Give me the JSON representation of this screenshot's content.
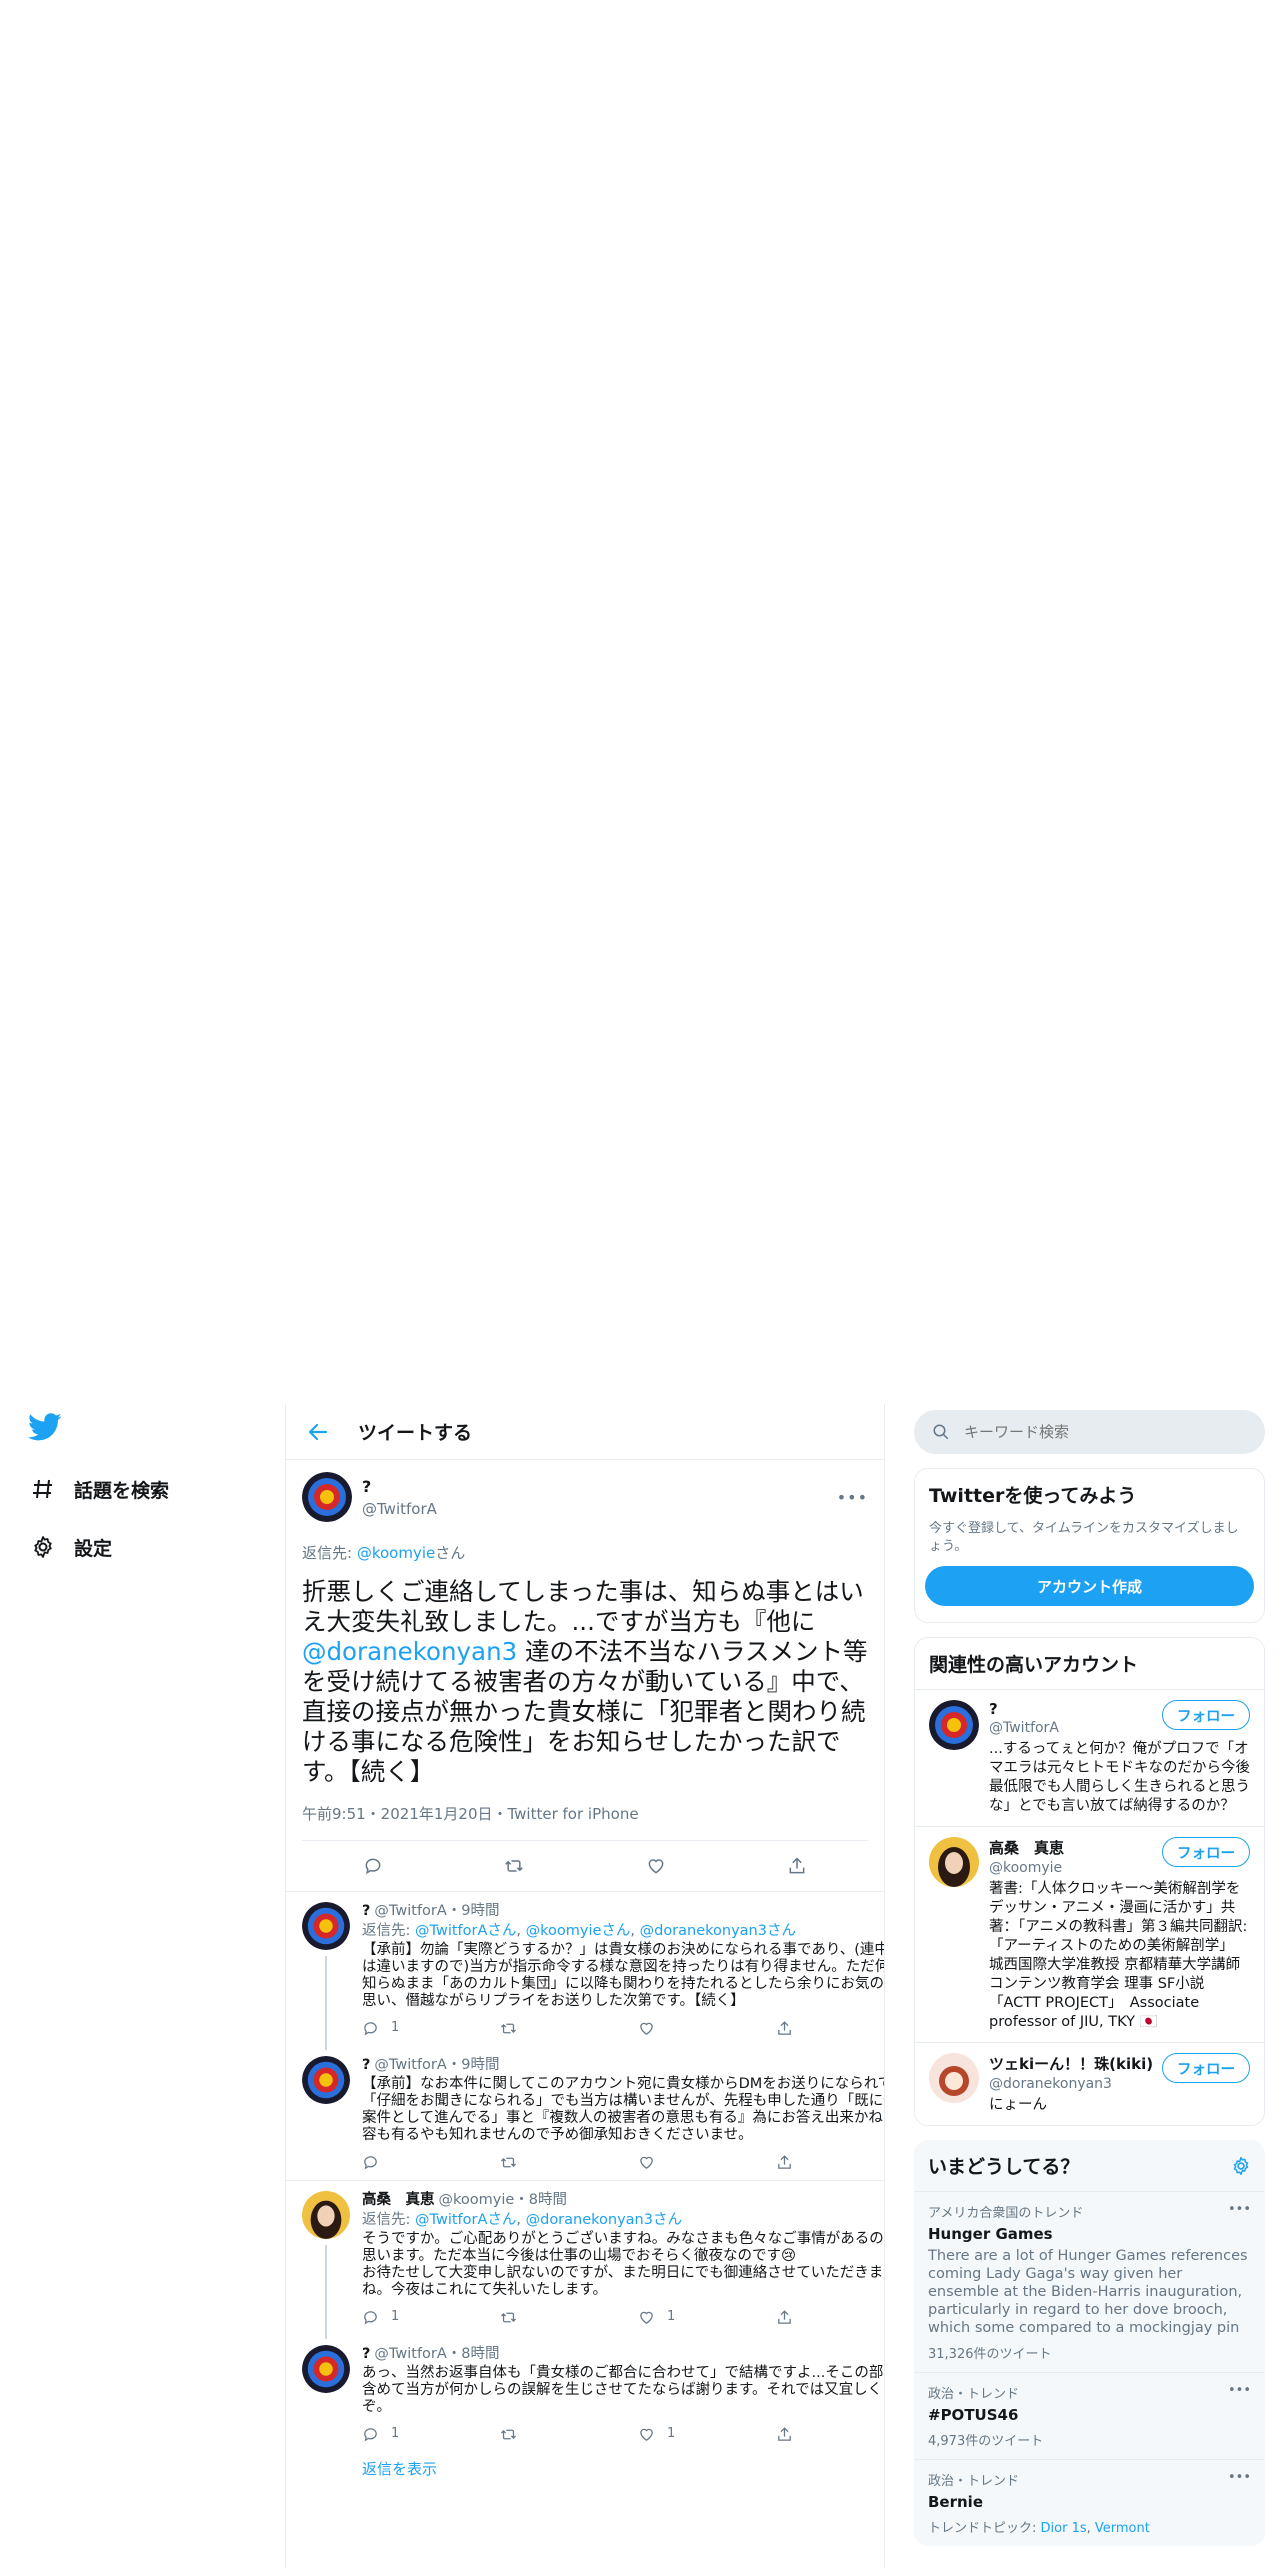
{
  "nav": {
    "items": [
      {
        "label": "話題を検索",
        "icon": "hashtag-icon"
      },
      {
        "label": "設定",
        "icon": "gear-icon"
      }
    ]
  },
  "header": {
    "title": "ツイートする"
  },
  "focus": {
    "name": "?",
    "handle": "@TwitforA",
    "reply_prefix": "返信先: ",
    "reply_user": "@koomyie",
    "reply_suffix": "さん",
    "text_1": "折悪しくご連絡してしまった事は、知らぬ事とはいえ大変失礼致しました。...ですが当方も『他に",
    "mention": "@doranekonyan3",
    "text_2": " 達の不法不当なハラスメント等を受け続けてる被害者の方々が動いている』中で、直接の接点が無かった貴女様に「犯罪者と関わり続ける事になる危険性」をお知らせしたかった訳です。【続く】",
    "meta": "午前9:51・2021年1月20日・Twitter for iPhone"
  },
  "replies": [
    {
      "name": "?",
      "handle": "@TwitforA",
      "time": "・9時間",
      "reply_prefix": "返信先: ",
      "reply_to_1": "@TwitforAさん",
      "reply_to_2": "@koomyieさん",
      "reply_to_3": "@doranekonyan3さん",
      "text": "【承前】勿論「実際どうするか？」は貴女様のお決めになられる事であり、(連中とは違いますので)当方が指示命令する様な意図を持ったりは有り得ません。ただ何も知らぬまま「あのカルト集団」に以降も関わりを持たれるとしたら余りにお気の毒と思い、僭越ながらリプライをお送りした次第です。【続く】",
      "reply_count": "1",
      "like_count": ""
    },
    {
      "name": "?",
      "handle": "@TwitforA",
      "time": "・9時間",
      "text": "【承前】なお本件に関してこのアカウント宛に貴女様からDMをお送りになられて「仔細をお聞きになられる」でも当方は構いませんが、先程も申した通り「既に係争案件として進んでる」事と『複数人の被害者の意思も有る』為にお答え出来かねる内容も有るやも知れませんので予め御承知おきくださいませ。",
      "reply_count": "",
      "like_count": ""
    },
    {
      "name": "高桑　真恵",
      "handle": "@koomyie",
      "time": "・8時間",
      "reply_prefix": "返信先: ",
      "reply_to_1": "@TwitforAさん",
      "reply_to_2": "@doranekonyan3さん",
      "text": "そうですか。ご心配ありがとうございますね。みなさまも色々なご事情があるのだと思います。ただ本当に今後は仕事の山場でおそらく徹夜なのです😢\nお待たせして大変申し訳ないのですが、また明日にでも御連絡させていただきますね。今夜はこれにて失礼いたします。",
      "reply_count": "1",
      "like_count": "1"
    },
    {
      "name": "?",
      "handle": "@TwitforA",
      "time": "・8時間",
      "text": "あっ、当然お返事自体も「貴女様のご都合に合わせて」で結構ですよ...そこの部分を含めて当方が何かしらの誤解を生じさせてたならば謝ります。それでは又宜しくどうぞ。",
      "reply_count": "1",
      "like_count": "1"
    }
  ],
  "show_replies": "返信を表示",
  "search": {
    "placeholder": "キーワード検索"
  },
  "signup": {
    "title": "Twitterを使ってみよう",
    "desc": "今すぐ登録して、タイムラインをカスタマイズしましょう。",
    "button": "アカウント作成"
  },
  "related": {
    "title": "関連性の高いアカウント",
    "follow_label": "フォロー",
    "accounts": [
      {
        "name": "?",
        "handle": "@TwitforA",
        "bio": "...するってぇと何か？俺がプロフで「オマエラは元々ヒトモドキなのだから今後最低限でも人間らしく生きられると思うな」とでも言い放てば納得するのか？"
      },
      {
        "name": "高桑　真恵",
        "handle": "@koomyie",
        "bio": "著書:「人体クロッキー〜美術解剖学をデッサン・アニメ・漫画に活かす」共著：「アニメの教科書」第３編共同翻訳:「アーティストのための美術解剖学」 城西国際大学准教授 京都精華大学講師 コンテンツ教育学会 理事 SF小説「ACTT PROJECT」　Associate professor of JIU, TKY 🇯🇵"
      },
      {
        "name": "ツェkiーん！！珠(kiki)",
        "handle": "@doranekonyan3",
        "bio": "にょーん"
      }
    ]
  },
  "trends": {
    "title": "いまどうしてる？",
    "items": [
      {
        "context": "アメリカ合衆国のトレンド",
        "title": "Hunger Games",
        "desc": "There are a lot of Hunger Games references coming Lady Gaga's way given her ensemble at the Biden-Harris inauguration, particularly in regard to her dove brooch, which some compared to a mockingjay pin",
        "count": "31,326件のツイート"
      },
      {
        "context": "政治・トレンド",
        "title": "#POTUS46",
        "desc": "",
        "count": "4,973件のツイート"
      },
      {
        "context": "政治・トレンド",
        "title": "Bernie",
        "desc": "",
        "count": "",
        "topic_prefix": "トレンドトピック: ",
        "topic_1": "Dior 1s",
        "topic_2": "Vermont"
      }
    ]
  },
  "colors": {
    "accent": "#1da1f2",
    "muted": "#657786",
    "border": "#e6ecf0"
  }
}
